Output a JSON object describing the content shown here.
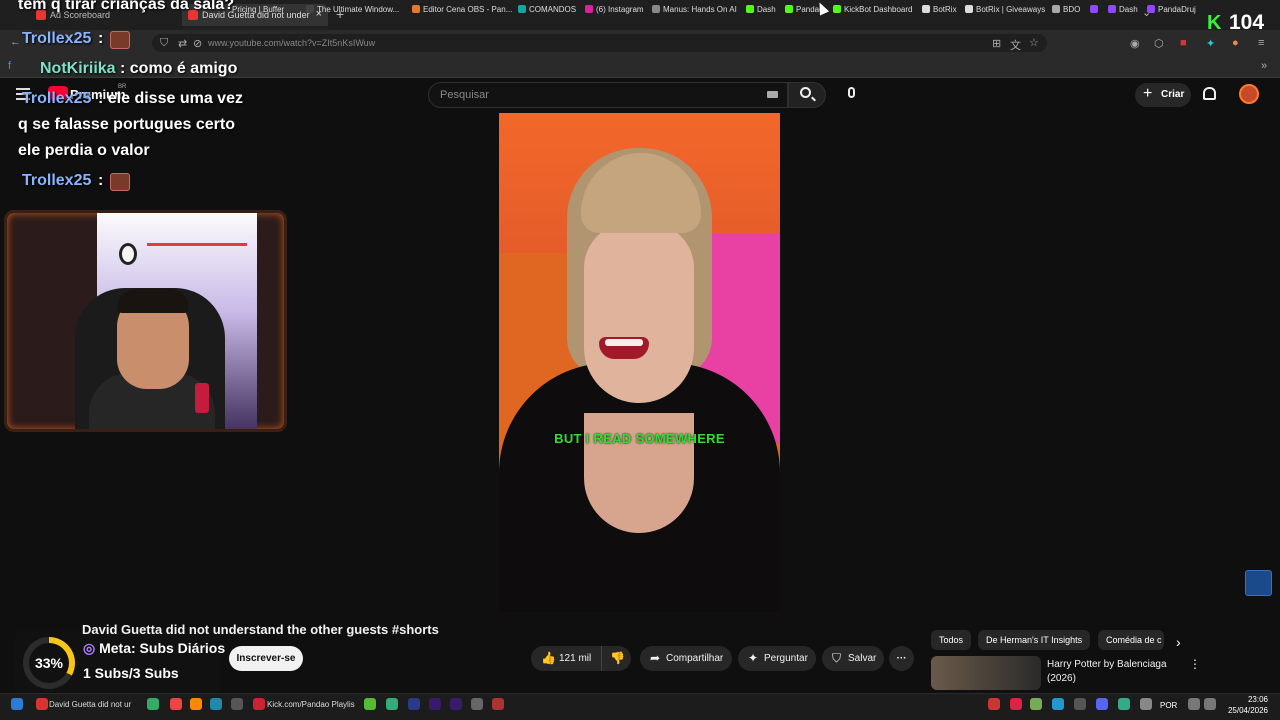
{
  "browser": {
    "tabs": [
      {
        "label": "Ad Scoreboard"
      },
      {
        "label": "David Guetta did not under"
      }
    ],
    "tab_close": "×",
    "new_tab": "+",
    "url": "www.youtube.com/watch?v=ZIt5nKsIWuw",
    "bookmarks": [
      {
        "label": "Pricing | Buffer",
        "color": "#888888"
      },
      {
        "label": "The Ultimate Window...",
        "color": "#444444"
      },
      {
        "label": "Editor Cena OBS - Pan...",
        "color": "#e8762b"
      },
      {
        "label": "COMANDOS",
        "color": "#13a89e"
      },
      {
        "label": "(6) Instagram",
        "color": "#d6249f"
      },
      {
        "label": "Manus: Hands On AI",
        "color": "#888888"
      },
      {
        "label": "Dash",
        "color": "#53fc18"
      },
      {
        "label": "Pandao",
        "color": "#53fc18"
      },
      {
        "label": "KickBot Dashboard",
        "color": "#53fc18"
      },
      {
        "label": "BotRix",
        "color": "#dddddd"
      },
      {
        "label": "BotRix | Giveaways",
        "color": "#dddddd"
      },
      {
        "label": "BDO",
        "color": "#aaaaaa"
      },
      {
        "label": "Dash",
        "color": "#9146ff"
      },
      {
        "label": "PandaDruj",
        "color": "#9146ff"
      }
    ]
  },
  "youtube": {
    "logo_text": "Premium",
    "region": "BR",
    "search_placeholder": "Pesquisar",
    "create_label": "Criar",
    "video_subtitle": "BUT I READ SOMEWHERE",
    "video_title": "David Guetta did not understand the other guests #shorts",
    "subscribe_label": "Inscrever-se",
    "actions": {
      "likes": "121 mil",
      "share": "Compartilhar",
      "ask": "Perguntar",
      "save": "Salvar",
      "more": "···"
    },
    "chips": [
      "Todos",
      "De Herman's IT Insights",
      "Comédia de c"
    ],
    "recommended": {
      "title": "Harry Potter by Balenciaga (2026)",
      "menu": "⋮"
    }
  },
  "stream_overlay": {
    "chat": [
      {
        "user": "",
        "message": "tem q tirar crianças da sala?"
      },
      {
        "user": "Trollex25",
        "message": ":"
      },
      {
        "user": "NotKiriika",
        "message": ": como é amigo"
      },
      {
        "user": "Trollex25",
        "message": ": ele disse uma vez"
      },
      {
        "user": "",
        "message": "q se falasse portugues certo"
      },
      {
        "user": "",
        "message": "ele perdia o valor"
      },
      {
        "user": "Trollex25",
        "message": ":"
      }
    ],
    "goal": {
      "percent_label": "33%",
      "progress": 0.33,
      "title": "Meta: Subs Diários",
      "count": "1 Subs/3 Subs"
    },
    "viewer_count": "104",
    "kick_icon": "K"
  },
  "taskbar": {
    "items": [
      "David Guetta did not ur",
      "Kick.com/Pandao Playlis"
    ],
    "language": "POR",
    "time": "23:06",
    "date": "25/04/2026"
  },
  "colors": {
    "youtube_red": "#ff0033",
    "kick_green": "#53fc18",
    "subtitle_green": "#2fe02f",
    "goal_yellow": "#f5c518"
  }
}
